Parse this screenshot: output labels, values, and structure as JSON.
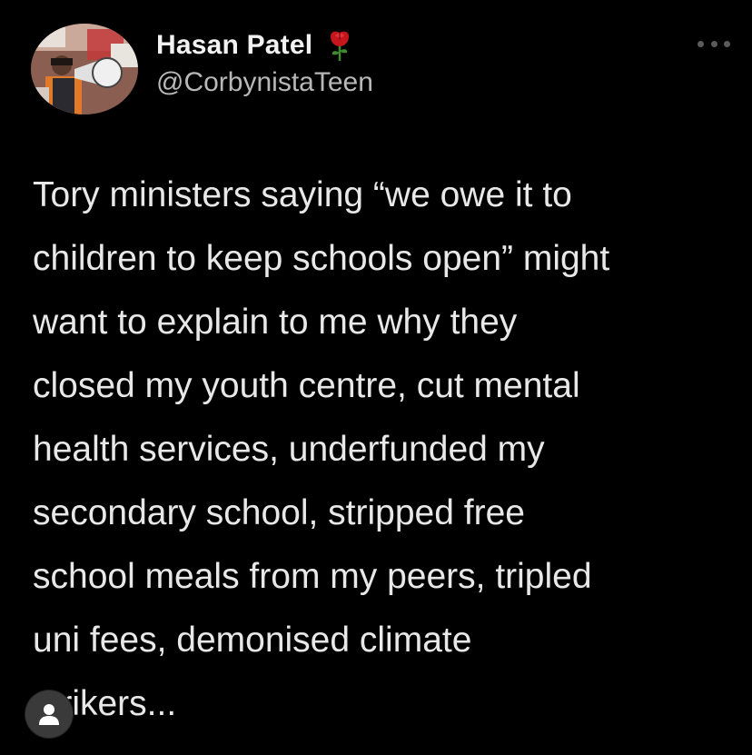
{
  "tweet": {
    "display_name": "Hasan Patel",
    "handle": "@CorbynistaTeen",
    "name_emoji_icon": "rose-icon",
    "more_icon": "more-horizontal-icon",
    "text": "Tory ministers saying “we owe it to\nchildren to keep schools open” might\nwant to explain to me why they\nclosed my youth centre, cut mental\nhealth services, underfunded my\nsecondary school, stripped free\nschool meals from my peers, tripled\nuni fees, demonised climate\nstrikers..."
  },
  "overlay": {
    "icon": "person-icon"
  },
  "colors": {
    "background": "#000000",
    "text": "#e8e8e8",
    "handle": "#b8b8b8",
    "rose": "#c4161c"
  }
}
